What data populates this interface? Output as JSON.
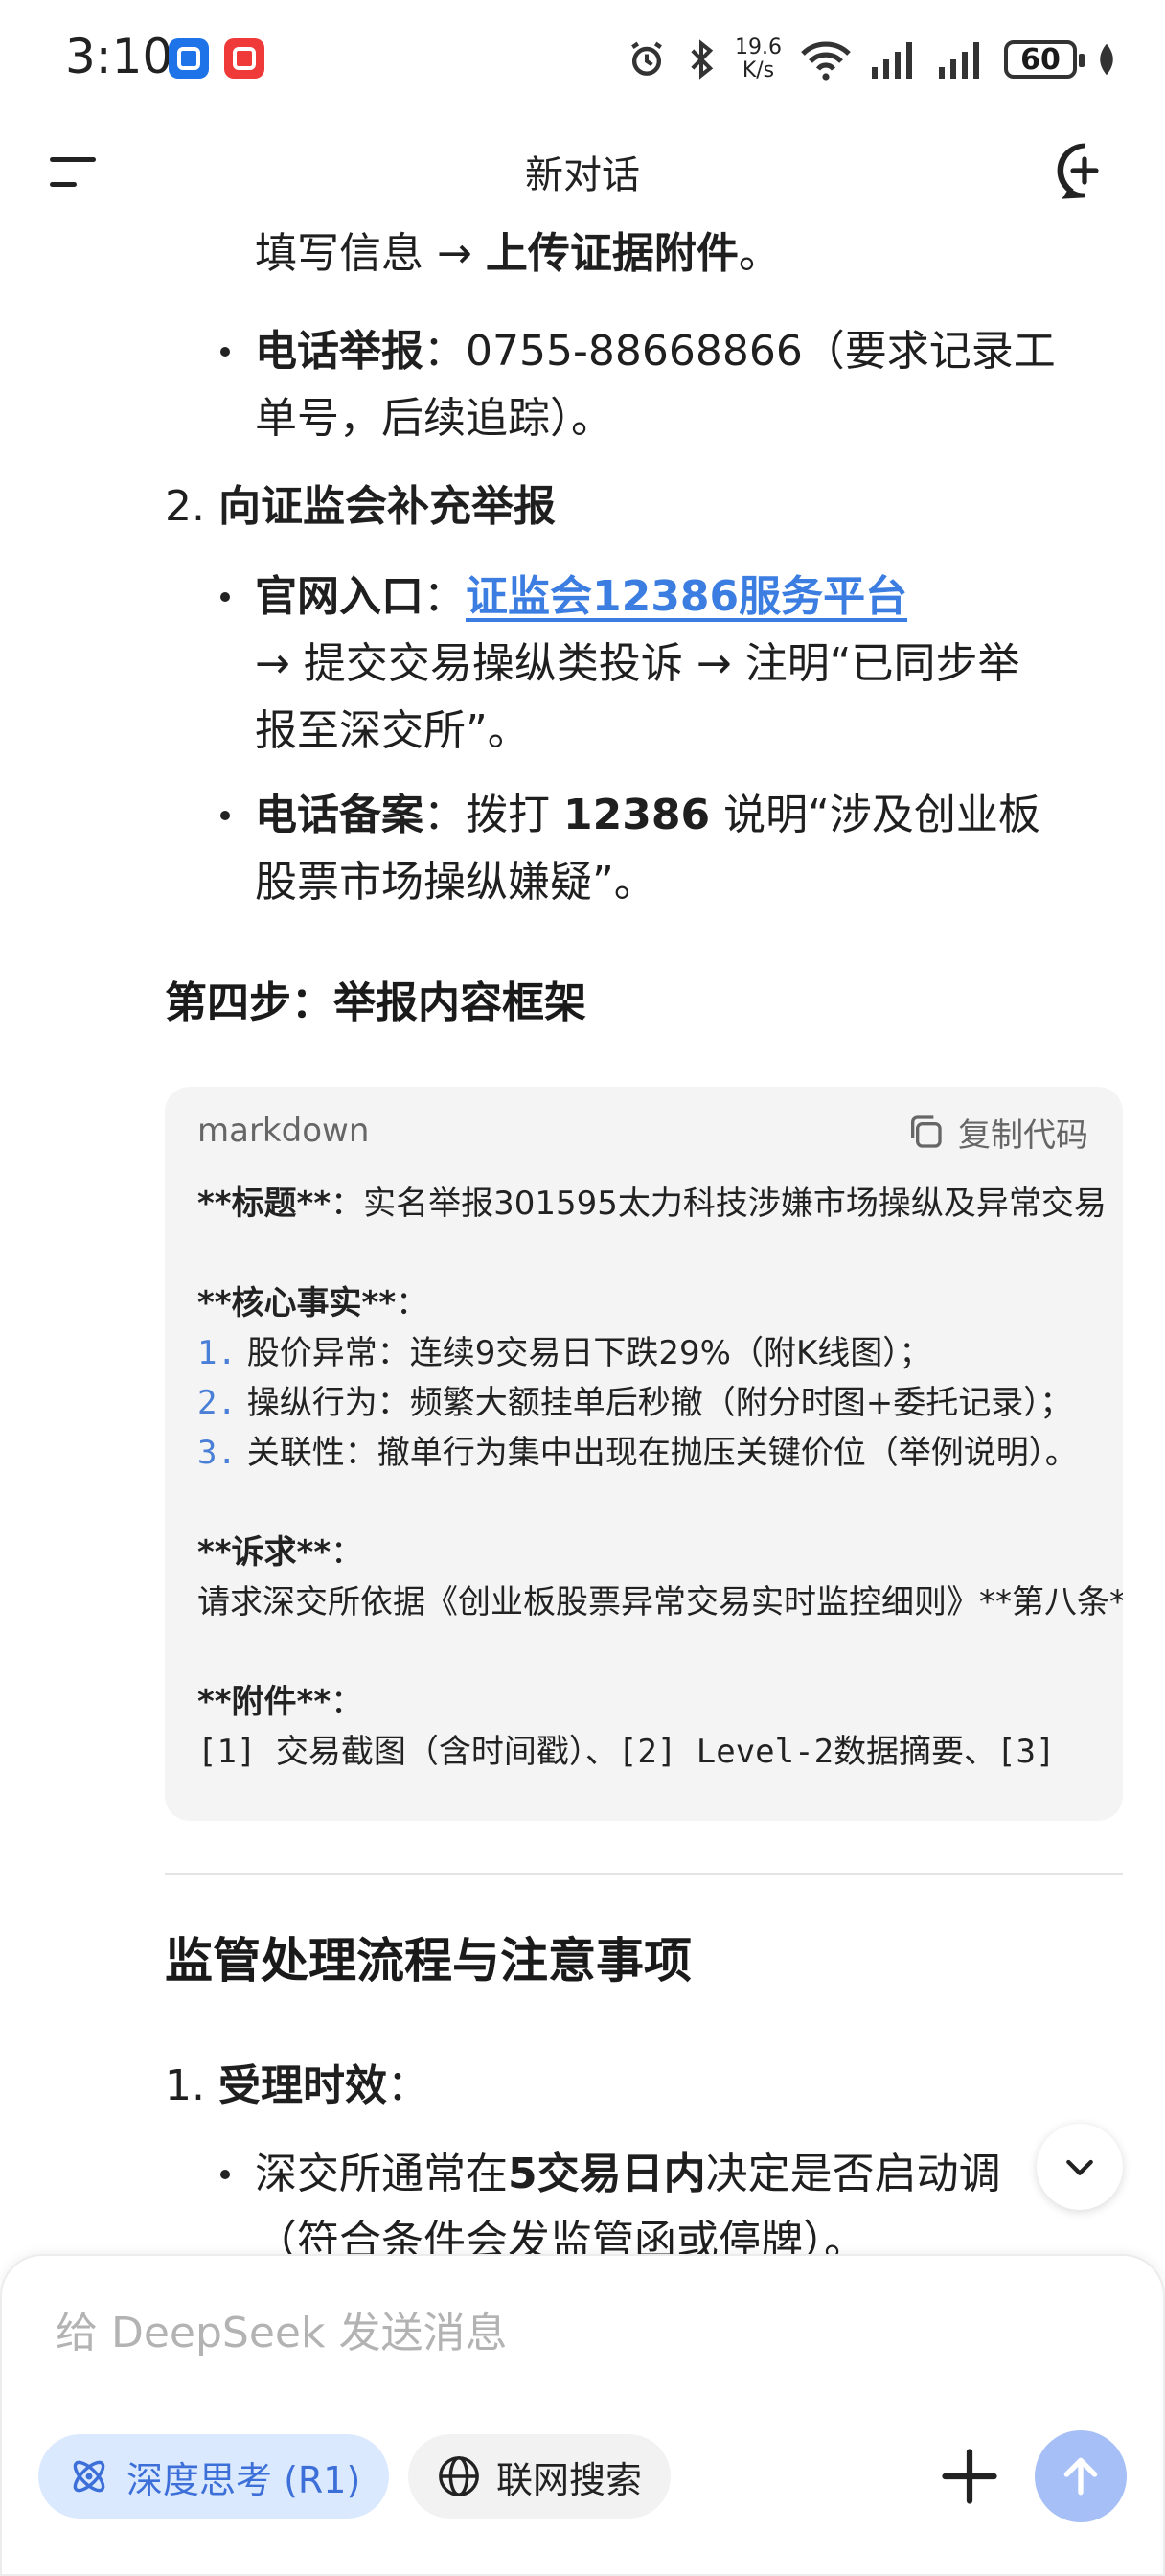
{
  "status_bar": {
    "time": "3:10",
    "net_speed_value": "19.6",
    "net_speed_unit": "K/s",
    "battery": "60"
  },
  "header": {
    "title": "新对话"
  },
  "content": {
    "line1_prefix": "填写信息 → ",
    "line1_bold": "上传证据附件",
    "line1_suffix": "。",
    "phone_label": "电话举报",
    "phone_colon": "：",
    "phone_text_1": "0755-88668866（要求记录工",
    "phone_text_2": "单号，后续追踪）。",
    "item2_num": "2.",
    "item2_title": "向证监会补充举报",
    "web_label": "官网入口",
    "web_colon": "：",
    "web_link": "证监会12386服务平台",
    "web_text_1": "→ 提交交易操纵类投诉 → 注明“已同步举",
    "web_text_2": "报至深交所”。",
    "tel_label": "电话备案",
    "tel_text_a": "：拨打 ",
    "tel_number": "12386",
    "tel_text_b": " 说明“涉及创业板",
    "tel_text_2": "股票市场操纵嫌疑”。",
    "step4_title": "第四步：举报内容框架",
    "code": {
      "lang": "markdown",
      "copy_label": "复制代码",
      "l_title_a": "**标题**",
      "l_title_b": "：实名举报301595太力科技涉嫌市场操纵及异常交易",
      "l_core": "**核心事实**",
      "l_core_colon": "：",
      "n1": "1.",
      "f1": "股价异常：连续9交易日下跌29%（附K线图）；",
      "n2": "2.",
      "f2": "操纵行为：频繁大额挂单后秒撤（附分时图+委托记录）；",
      "n3": "3.",
      "f3": "关联性：撤单行为集中出现在抛压关键价位（举例说明）。",
      "l_req": "**诉求**",
      "l_req_colon": "：",
      "req_text": "请求深交所依据《创业板股票异常交易实时监控细则》**第八条**",
      "l_att": "**附件**",
      "l_att_colon": "：",
      "att_a": "[1] ",
      "att_b": "交易截图（含时间戳）、",
      "att_c": "[2] Level-2",
      "att_d": "数据摘要、",
      "att_e": "[3]"
    },
    "section_title": "监管处理流程与注意事项",
    "sec1_num": "1.",
    "sec1_title": "受理时效",
    "sec1_colon": "：",
    "sec1_bullet_a": "深交所通常在",
    "sec1_bullet_bold": "5交易日内",
    "sec1_bullet_b": "决定是否启动调",
    "sec1_bullet_2": "（符合条件会发监管函或停牌）。"
  },
  "composer": {
    "placeholder": "给 DeepSeek 发送消息",
    "deep_think_label": "深度思考 (R1)",
    "web_search_label": "联网搜索"
  },
  "colors": {
    "accent": "#3d6fd8",
    "link": "#3b7de0",
    "send_button": "#a6bff6",
    "pill_active_bg": "#dbe9ff"
  }
}
